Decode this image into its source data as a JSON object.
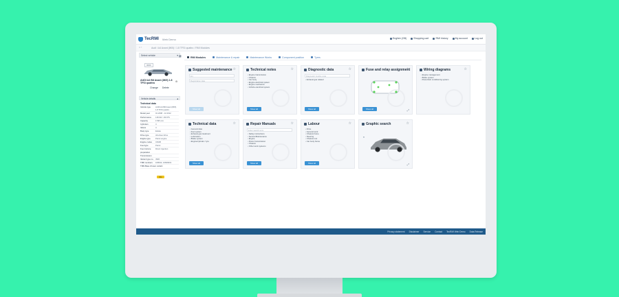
{
  "app": {
    "brand": "TecRMI",
    "brand_sub": "Web Demo",
    "top_links": [
      "English (GB)",
      "Shopping cart",
      "RMI history",
      "My account",
      "Log out"
    ]
  },
  "breadcrumb": {
    "home_label": "⌂ ‹",
    "path": "Audi / A4 Avant (8K5) / 1.8 TFSI quattro / RMI Modules"
  },
  "left_panel": {
    "select_vehicle_label": "Select vehicle",
    "select_vehicle_icon": "chevron-down-icon",
    "vehicle_tag": "0000",
    "vehicle_name": "AUDI A4 B8 Avant (8K5) 1.8 TFSI quattro",
    "change_label": "Change",
    "delete_label": "Delete",
    "details_header": "Vehicle details",
    "technical_data_heading": "Technical data",
    "details_rows": [
      {
        "k": "Vehicle type",
        "v": "AUDI A4 B8 Avant (8K5) 1.8 TFSI quattro"
      },
      {
        "k": "Model year",
        "v": "01.2008 - 12.2012"
      },
      {
        "k": "Performance",
        "v": "118 kW / 160 PS"
      },
      {
        "k": "Capacity",
        "v": "1798 ccm"
      },
      {
        "k": "Cylinders",
        "v": "4"
      },
      {
        "k": "Valves",
        "v": "4"
      },
      {
        "k": "Body type",
        "v": "Estate"
      },
      {
        "k": "Drive type",
        "v": "All-wheel drive"
      },
      {
        "k": "Engine type",
        "v": "Petrol engine"
      },
      {
        "k": "Engine codes",
        "v": "CDHB"
      },
      {
        "k": "Fuel type",
        "v": "Petrol"
      },
      {
        "k": "Fuel mixture preparation",
        "v": "Direct injection"
      },
      {
        "k": "Transmission",
        "v": ""
      },
      {
        "k": "Variant type no.",
        "v": "4WD"
      },
      {
        "k": "TMD numbers",
        "v": "108640, 10849001"
      }
    ],
    "tmd_label": "TMD-Base chosen variant",
    "yellow_button": "Info"
  },
  "tabs": [
    {
      "label": "RMI Modules",
      "active": true
    },
    {
      "label": "Maintenance & repair",
      "active": false
    },
    {
      "label": "Maintenance Works",
      "active": false
    },
    {
      "label": "Component position",
      "active": false
    },
    {
      "label": "Tyres",
      "active": false
    }
  ],
  "cards": [
    {
      "title": "Suggested maintenance",
      "items": [],
      "inputs": [
        "km",
        "Registration date"
      ],
      "button": "Show all",
      "button_faded": true
    },
    {
      "title": "Technical notes",
      "items": [
        "Engine transmission",
        "Chassis",
        "Car body",
        "Engine electrical system",
        "Engine mechanics",
        "Vehicle electrical system"
      ],
      "inputs": [],
      "button": "Show all",
      "button_faded": false
    },
    {
      "title": "Diagnostic data",
      "items": [
        "Exhaust gas related"
      ],
      "inputs": [
        "Diagnostic trouble code"
      ],
      "button": "Show all",
      "button_faded": false
    },
    {
      "title": "Fuse and relay assignment",
      "items": [],
      "inputs": [],
      "button": "Show all",
      "button_faded": false
    },
    {
      "title": "Wiring diagrams",
      "items": [
        "Engine management",
        "Brake system",
        "Powertrain conditioning system"
      ],
      "inputs": [],
      "button": "",
      "button_faded": false
    },
    {
      "title": "Technical data",
      "items": [
        "General data",
        "Fuel system",
        "Exhaust gas treatment",
        "Lubrication",
        "Brake system",
        "Engine/cylinder / tyre"
      ],
      "inputs": [],
      "button": "Show all",
      "button_faded": false
    },
    {
      "title": "Repair Manuals",
      "items": [
        "Safety instructions",
        "Service/Maintenance",
        "Engine",
        "Power transmission",
        "Chassis",
        "Other work systems"
      ],
      "inputs": [
        "Enter search term"
      ],
      "button": "Show all",
      "button_faded": false
    },
    {
      "title": "Labour",
      "items": [
        "Drive",
        "General work",
        "Chassis frame",
        "Steering",
        "Chassis rust",
        "Car body frame"
      ],
      "inputs": [],
      "button": "Show all",
      "button_faded": false
    },
    {
      "title": "Graphic search",
      "items": [],
      "inputs": [],
      "button": "",
      "button_faded": false
    }
  ],
  "footer": {
    "links": [
      "Privacy statement",
      "Disclaimer",
      "Service",
      "Contact",
      "TecRMI Web Demo",
      "Data Release"
    ]
  },
  "colors": {
    "background": "#36f2ad",
    "accent": "#3a92d4",
    "footer": "#1f5a8a"
  }
}
